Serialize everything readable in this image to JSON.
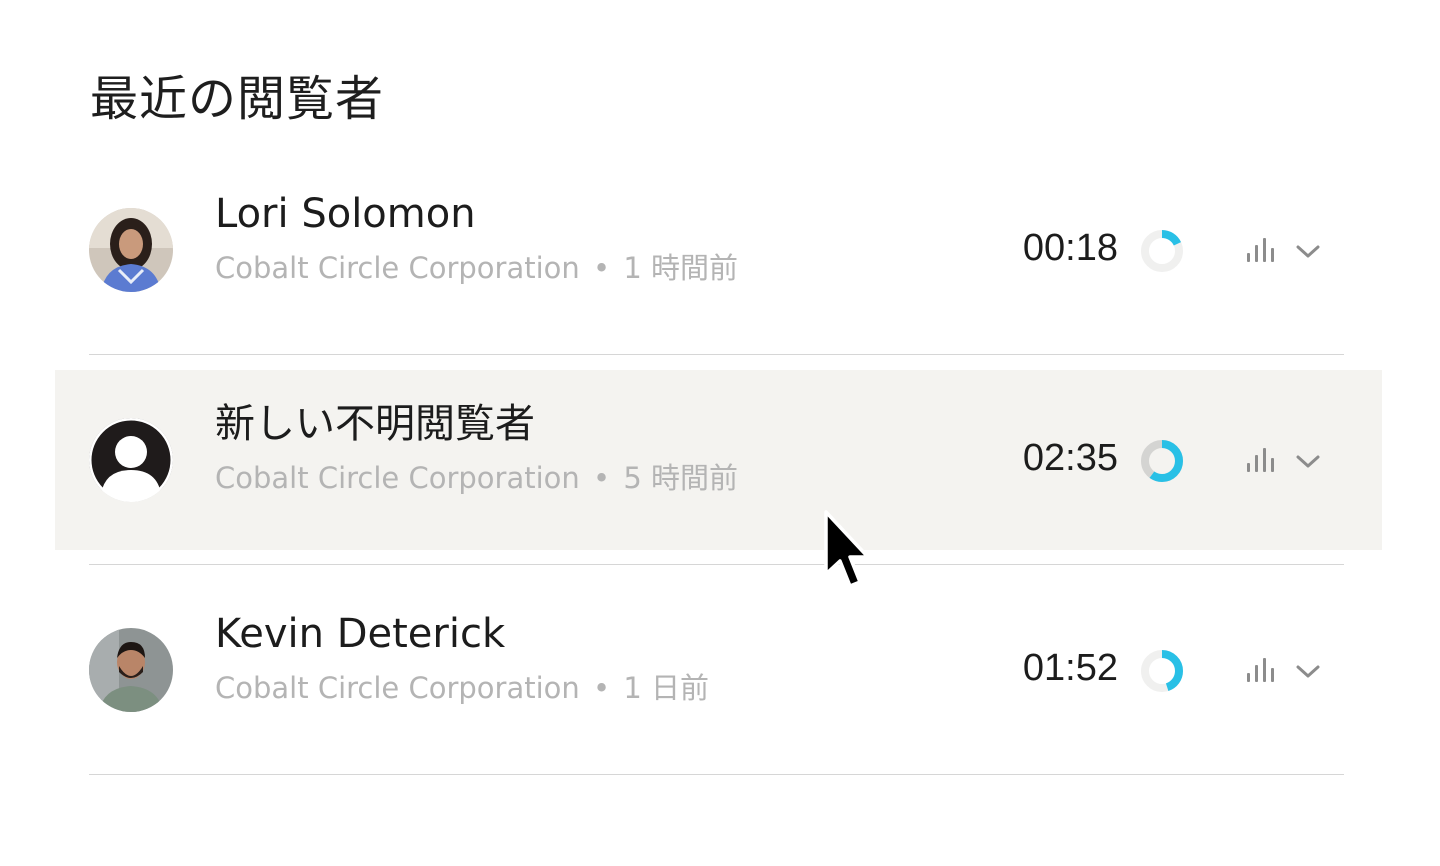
{
  "header": {
    "title": "最近の閲覧者"
  },
  "viewers": [
    {
      "name": "Lori Solomon",
      "company": "Cobalt Circle Corporation",
      "separator": "•",
      "time_ago": "1 時間前",
      "duration": "00:18",
      "watched_fraction": 0.18,
      "avatar": "photo-woman"
    },
    {
      "name": "新しい不明閲覧者",
      "company": "Cobalt Circle Corporation",
      "separator": "•",
      "time_ago": "5 時間前",
      "duration": "02:35",
      "watched_fraction": 0.6,
      "avatar": "anonymous-user-icon"
    },
    {
      "name": "Kevin Deterick",
      "company": "Cobalt Circle Corporation",
      "separator": "•",
      "time_ago": "1 日前",
      "duration": "01:52",
      "watched_fraction": 0.45,
      "avatar": "photo-man"
    }
  ],
  "colors": {
    "accent": "#29c0e6",
    "donut_track_light": "#f0f0ef",
    "donut_track_dark": "#d4d4d2",
    "hover_background": "#f4f3f0",
    "meta_text": "#b4b4b4",
    "icon_gray": "#8c8c8c"
  },
  "icons": {
    "stats": "bar-chart-icon",
    "expand": "chevron-down-icon",
    "pointer": "mouse-cursor-icon"
  }
}
